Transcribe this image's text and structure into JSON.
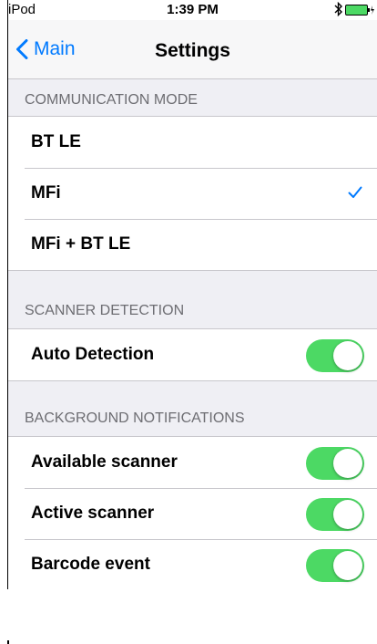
{
  "status_bar": {
    "carrier": "iPod",
    "time": "1:39 PM"
  },
  "nav": {
    "back_label": "Main",
    "title": "Settings"
  },
  "communication_mode": {
    "header": "COMMUNICATION MODE",
    "options": [
      {
        "label": "BT LE",
        "selected": false
      },
      {
        "label": "MFi",
        "selected": true
      },
      {
        "label": "MFi + BT LE",
        "selected": false
      }
    ]
  },
  "scanner_detection": {
    "header": "SCANNER DETECTION",
    "items": [
      {
        "label": "Auto Detection",
        "on": true
      }
    ]
  },
  "background_notifications": {
    "header": "BACKGROUND NOTIFICATIONS",
    "items": [
      {
        "label": "Available scanner",
        "on": true
      },
      {
        "label": "Active scanner",
        "on": true
      },
      {
        "label": "Barcode event",
        "on": true
      }
    ]
  },
  "colors": {
    "accent": "#007aff",
    "toggle_on": "#4cd964",
    "background": "#efeff4",
    "separator": "#c8c7cc"
  },
  "icons": {
    "back": "chevron-left-icon",
    "bluetooth": "bluetooth-icon",
    "battery": "battery-charging-icon",
    "check": "checkmark-icon"
  }
}
